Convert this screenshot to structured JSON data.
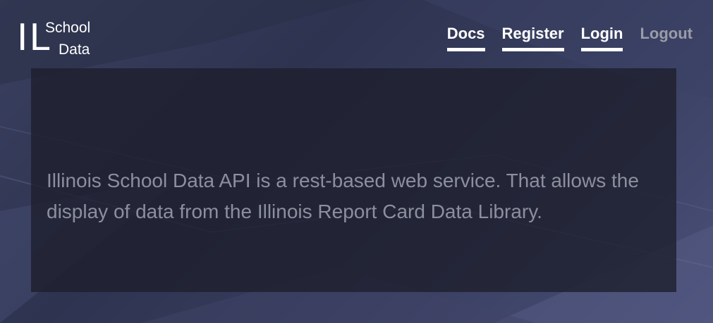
{
  "brand": {
    "mark": "IL",
    "line1": "School",
    "line2": "Data"
  },
  "nav": {
    "docs": "Docs",
    "register": "Register",
    "login": "Login",
    "logout": "Logout"
  },
  "hero": {
    "description": "Illinois School Data API is a rest-based web service. That allows the display of data from the Illinois Report Card Data Library."
  },
  "colors": {
    "background": "#2e3350",
    "panel": "#1e202e",
    "text_muted": "#8c8f9e",
    "nav_active": "#ffffff",
    "nav_inactive": "#9a9ca8"
  }
}
